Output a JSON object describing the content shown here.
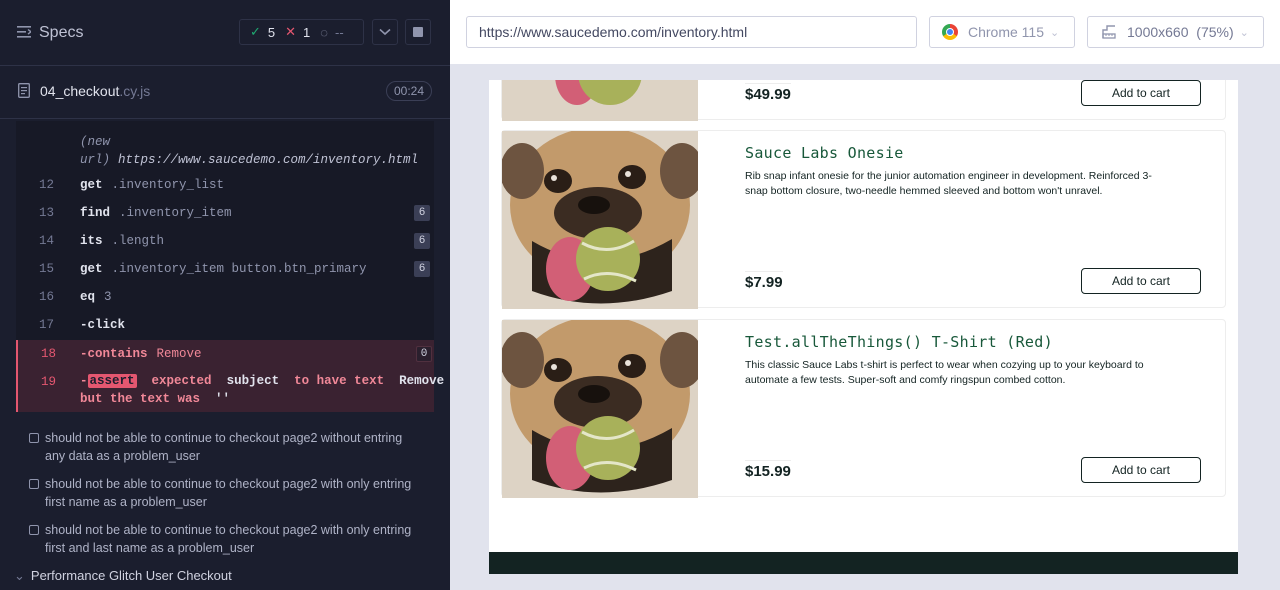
{
  "runner": {
    "specs_title": "Specs",
    "stats": {
      "passed": "5",
      "failed": "1",
      "pending": "--"
    },
    "spec_file": {
      "name": "04_checkout",
      "ext": ".cy.js",
      "duration": "00:24"
    },
    "url_event": {
      "label_1": "(new",
      "label_2": "url)",
      "url": "https://www.saucedemo.com/inventory.html"
    },
    "commands": [
      {
        "line": "12",
        "name": "get",
        "message": ".inventory_list",
        "count": ""
      },
      {
        "line": "13",
        "name": "find",
        "message": ".inventory_item",
        "count": "6"
      },
      {
        "line": "14",
        "name": "its",
        "message": ".length",
        "count": "6"
      },
      {
        "line": "15",
        "name": "get",
        "message": ".inventory_item button.btn_primary",
        "count": "6"
      },
      {
        "line": "16",
        "name": "eq",
        "message": "3",
        "count": ""
      },
      {
        "line": "17",
        "name": "-click",
        "message": "",
        "count": ""
      },
      {
        "line": "18",
        "name": "-contains",
        "message": "Remove",
        "count": "0"
      }
    ],
    "assertion": {
      "line": "19",
      "prefix": "-",
      "tag": "assert",
      "text_1": "expected",
      "subject": "subject",
      "text_2": "to have text",
      "value": "Remove",
      "comma": ",",
      "text_3": "but the text was",
      "actual": "''"
    },
    "tests": [
      "should not be able to continue to checkout page2 without entring any data as a problem_user",
      "should not be able to continue to checkout page2 with only entring first name as a problem_user",
      "should not be able to continue to checkout page2 with only entring first and last name as a problem_user"
    ],
    "suite": "Performance Glitch User Checkout"
  },
  "aut_bar": {
    "url": "https://www.saucedemo.com/inventory.html",
    "browser": "Chrome 115",
    "viewport": "1000x660",
    "zoom": "(75%)"
  },
  "products": [
    {
      "name": "",
      "description": "",
      "price": "$49.99",
      "button": "Add to cart"
    },
    {
      "name": "Sauce Labs Onesie",
      "description": "Rib snap infant onesie for the junior automation engineer in development. Reinforced 3-snap bottom closure, two-needle hemmed sleeved and bottom won't unravel.",
      "price": "$7.99",
      "button": "Add to cart"
    },
    {
      "name": "Test.allTheThings() T-Shirt (Red)",
      "description": "This classic Sauce Labs t-shirt is perfect to wear when cozying up to your keyboard to automate a few tests. Super-soft and comfy ringspun combed cotton.",
      "price": "$15.99",
      "button": "Add to cart"
    }
  ],
  "colors": {
    "pass": "#1fa971",
    "fail": "#e45770",
    "runner_bg": "#1b1e2e",
    "product_title": "#18583a"
  }
}
